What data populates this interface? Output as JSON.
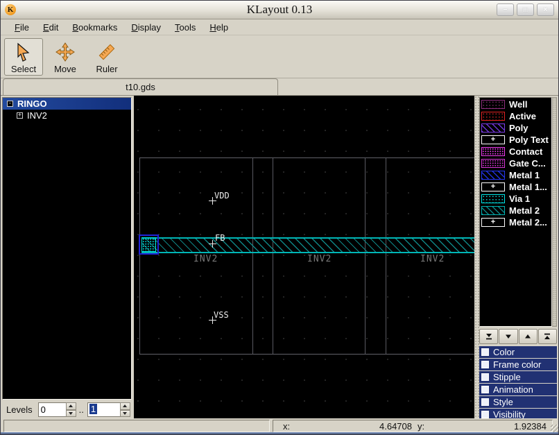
{
  "window": {
    "title": "KLayout 0.13",
    "app_icon_letter": "K",
    "controls": {
      "minimize": "−",
      "maximize": "□",
      "close": "×"
    }
  },
  "menu": {
    "items": [
      {
        "accel": "F",
        "rest": "ile"
      },
      {
        "accel": "E",
        "rest": "dit"
      },
      {
        "accel": "B",
        "rest": "ookmarks"
      },
      {
        "accel": "D",
        "rest": "isplay"
      },
      {
        "accel": "T",
        "rest": "ools"
      },
      {
        "accel": "H",
        "rest": "elp"
      }
    ]
  },
  "toolbar": {
    "buttons": [
      {
        "label": "Select",
        "icon": "cursor-icon",
        "active": true
      },
      {
        "label": "Move",
        "icon": "move-icon",
        "active": false
      },
      {
        "label": "Ruler",
        "icon": "ruler-icon",
        "active": false
      }
    ]
  },
  "tabs": [
    {
      "label": "t10.gds"
    }
  ],
  "cell_tree": {
    "items": [
      {
        "label": "RINGO",
        "expander": "-",
        "selected": true
      },
      {
        "label": "INV2",
        "expander": "+",
        "selected": false
      }
    ]
  },
  "levels": {
    "label": "Levels",
    "from": "0",
    "separator": "..",
    "to": "1"
  },
  "canvas": {
    "pin_labels": [
      {
        "text": "VDD"
      },
      {
        "text": "FB"
      },
      {
        "text": "VSS"
      }
    ],
    "instance_labels": [
      "INV2",
      "INV2",
      "INV2"
    ],
    "colors": {
      "background": "#000000",
      "grid_dots": "#2d2d2d",
      "cell_boundary": "#62626a",
      "metal2_frame": "#00b6b6",
      "metal2_hatch": "#0d8c8c",
      "via_frame": "#2222d8",
      "via_dots": "#00e2e2",
      "selection_box": "#2222d8"
    }
  },
  "layers": {
    "items": [
      {
        "label": "Well",
        "frame": "#8e2e7e",
        "fill": "#7c2868",
        "pattern": "dots"
      },
      {
        "label": "Active",
        "frame": "#e42222",
        "fill": "#cc2020",
        "pattern": "dots"
      },
      {
        "label": "Poly",
        "frame": "#7c3ce8",
        "fill": "#6c34d4",
        "pattern": "hatch"
      },
      {
        "label": "Poly Text",
        "frame": "#ffffff",
        "fill": "#000000",
        "pattern": "plus",
        "glyph": "+"
      },
      {
        "label": "Contact",
        "frame": "#f23cf2",
        "fill": "#e838e8",
        "pattern": "dots"
      },
      {
        "label": "Gate C...",
        "frame": "#d836d8",
        "fill": "#c832c8",
        "pattern": "dots"
      },
      {
        "label": "Metal 1",
        "frame": "#2436f0",
        "fill": "#2030dc",
        "pattern": "hatch"
      },
      {
        "label": "Metal 1...",
        "frame": "#ffffff",
        "fill": "#000000",
        "pattern": "plus",
        "glyph": "+"
      },
      {
        "label": "Via 1",
        "frame": "#00e8e8",
        "fill": "#00d8d8",
        "pattern": "dots"
      },
      {
        "label": "Metal 2",
        "frame": "#00b4b4",
        "fill": "#0d8484",
        "pattern": "hatch"
      },
      {
        "label": "Metal 2...",
        "frame": "#ffffff",
        "fill": "#000000",
        "pattern": "plus",
        "glyph": "+"
      }
    ],
    "arrow_buttons": [
      "move-to-bottom",
      "move-down",
      "move-up",
      "move-to-top"
    ]
  },
  "group_headers": [
    {
      "label": "Color"
    },
    {
      "label": "Frame color"
    },
    {
      "label": "Stipple"
    },
    {
      "label": "Animation"
    },
    {
      "label": "Style"
    },
    {
      "label": "Visibility"
    }
  ],
  "status": {
    "x_label": "x:",
    "x_value": "4.64708",
    "y_label": "y:",
    "y_value": "1.92384"
  }
}
